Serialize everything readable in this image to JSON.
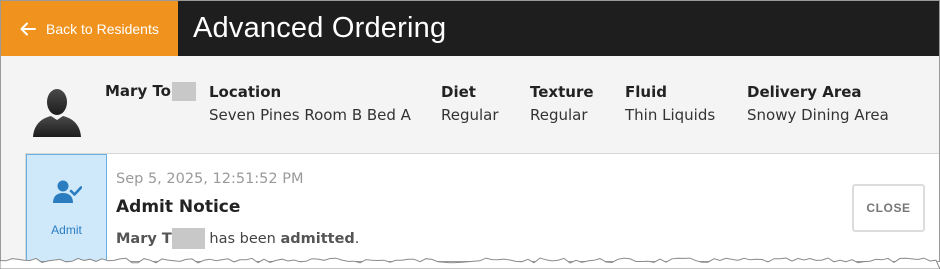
{
  "header": {
    "back_label": "Back to Residents",
    "title": "Advanced Ordering"
  },
  "resident": {
    "name": "Mary To",
    "fields": [
      {
        "label": "Location",
        "value": "Seven Pines Room B Bed A"
      },
      {
        "label": "Diet",
        "value": "Regular"
      },
      {
        "label": "Texture",
        "value": "Regular"
      },
      {
        "label": "Fluid",
        "value": "Thin Liquids"
      },
      {
        "label": "Delivery Area",
        "value": "Snowy Dining Area"
      }
    ]
  },
  "notice": {
    "badge_label": "Admit",
    "badge_icon": "user-check-icon",
    "timestamp": "Sep 5, 2025, 12:51:52 PM",
    "title": "Admit Notice",
    "message_name": "Mary T",
    "message_middle": " has been ",
    "message_status": "admitted",
    "message_end": ".",
    "close_label": "CLOSE"
  },
  "colors": {
    "header_bg": "#1e1e1e",
    "back_button_bg": "#f0931e",
    "badge_bg": "#cfe9fb",
    "badge_accent": "#2b7dc0"
  }
}
